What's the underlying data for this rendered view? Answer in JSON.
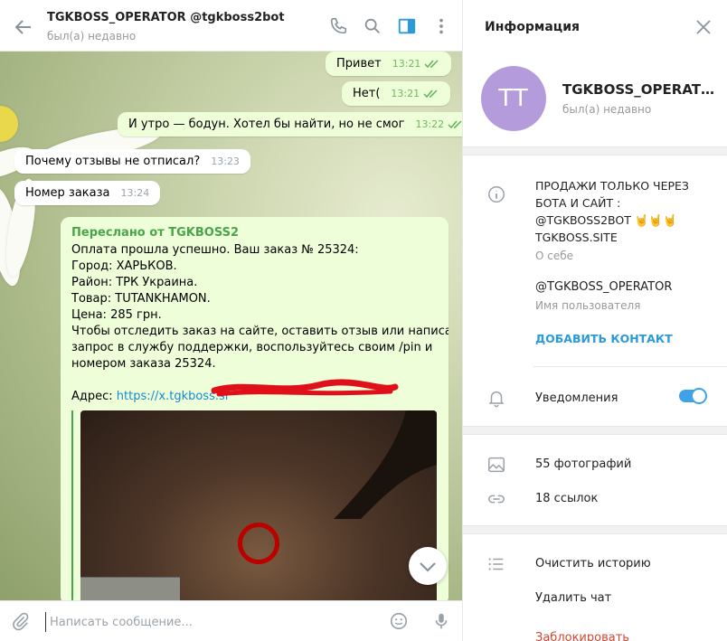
{
  "chat": {
    "header": {
      "title": "TGKBOSS_OPERATOR @tgkboss2bot",
      "status": "был(а) недавно"
    },
    "messages": [
      {
        "text": "Привет",
        "time": "13:21",
        "outgoing": true
      },
      {
        "text": "Нет(",
        "time": "13:21",
        "outgoing": true
      },
      {
        "text": "И утро — бодун. Хотел бы найти, но не смог",
        "time": "13:22",
        "outgoing": true
      },
      {
        "text": "Почему отзывы не отписал?",
        "time": "13:23",
        "outgoing": false
      },
      {
        "text": "Номер заказа",
        "time": "13:24",
        "outgoing": false
      }
    ],
    "forwarded": {
      "from_label": "Переслано от TGKBOSS2",
      "lines": [
        "Оплата прошла успешно. Ваш заказ № 25324:",
        "Город: ХАРЬКОВ.",
        "Район: ТРК Украина.",
        "Товар: TUTANKHAMON.",
        "Цена: 285 грн.",
        "Чтобы отследить заказ на сайте, оставить отзыв или написать",
        "запрос в службу поддержки, воспользуйтесь своим /pin и",
        "номером заказа 25324."
      ],
      "address_label": "Адрес: ",
      "address_link": "https://x.tgkboss.si"
    },
    "composer": {
      "placeholder": "Написать сообщение..."
    }
  },
  "info": {
    "title": "Информация",
    "avatar_initials": "TT",
    "name": "TGKBOSS_OPERATOR",
    "status": "был(а) недавно",
    "bio_lines": [
      "ПРОДАЖИ ТОЛЬКО ЧЕРЕЗ",
      "БОТА И САЙТ :",
      "@TGKBOSS2BOT 🤘🤘🤘",
      "TGKBOSS.SITE"
    ],
    "bio_label": "О себе",
    "username": "@TGKBOSS_OPERATOR",
    "username_label": "Имя пользователя",
    "add_contact": "ДОБАВИТЬ КОНТАКТ",
    "notifications": "Уведомления",
    "notifications_on": true,
    "photos": "55 фотографий",
    "links": "18 ссылок",
    "clear_history": "Очистить историю",
    "delete_chat": "Удалить чат",
    "block": "Заблокировать"
  },
  "colors": {
    "accent": "#2a9bd6",
    "outgoing_bubble": "#eefed8",
    "avatar": "#b39bdc",
    "danger": "#d14836"
  }
}
